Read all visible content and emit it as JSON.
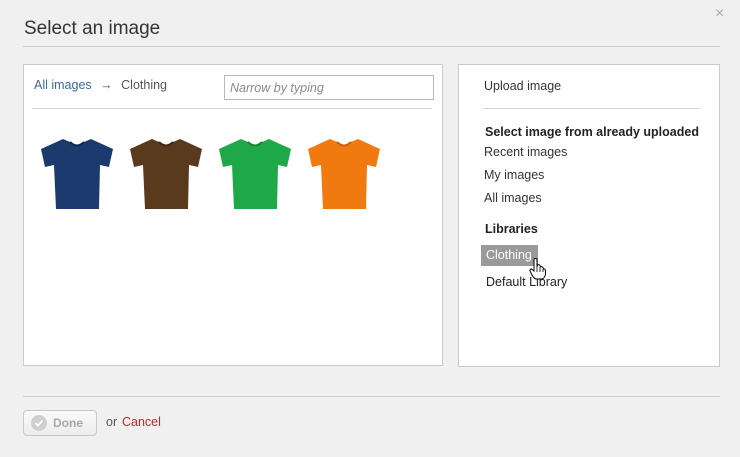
{
  "dialog": {
    "title": "Select an image",
    "close_glyph": "×"
  },
  "browser": {
    "breadcrumb": {
      "root": "All images",
      "arrow": "→",
      "current": "Clothing"
    },
    "search_placeholder": "Narrow by typing",
    "search_value": "",
    "images": [
      {
        "icon": "navy-tshirt",
        "color": "#1d3a6e"
      },
      {
        "icon": "brown-tshirt",
        "color": "#5a3a1c"
      },
      {
        "icon": "green-tshirt",
        "color": "#1fa847"
      },
      {
        "icon": "orange-tshirt",
        "color": "#f07a10"
      }
    ]
  },
  "sidebar": {
    "upload": "Upload image",
    "select_heading": "Select image from already uploaded",
    "sources": [
      "Recent images",
      "My images",
      "All images"
    ],
    "libraries_heading": "Libraries",
    "libraries": [
      "Clothing",
      "Default Library"
    ],
    "selected_library": "Clothing"
  },
  "footer": {
    "done": "Done",
    "or": "or",
    "cancel": "Cancel"
  },
  "colors": {
    "link": "#3b6aa0",
    "cancel": "#c0282d",
    "selected_bg": "#9a9a9a"
  }
}
